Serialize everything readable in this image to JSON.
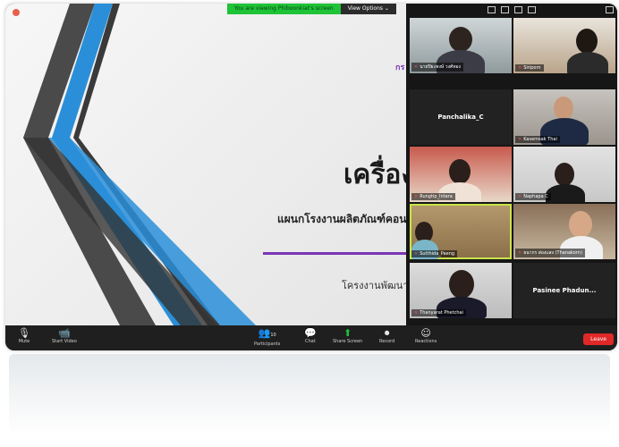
{
  "banner": {
    "message": "You are viewing Phiboonkiat's screen",
    "options_label": "View Options ⌄"
  },
  "slide": {
    "logo_text": "กร",
    "title": "เครื่อง",
    "subtitle": "แผนกโรงงานผลิตภัณฑ์คอน",
    "project": "โครงงานพัฒนา",
    "accent_color": "#7b35b5",
    "stripe_blue": "#2a8fd8",
    "stripe_dark": "#4a4a4a"
  },
  "gallery": {
    "participants": [
      {
        "name": "นายปิยะพงษ์ วงศ์ทอง",
        "video": true
      },
      {
        "name": "Siriporn",
        "video": true
      },
      {
        "name": "Panchalika_C",
        "video": false
      },
      {
        "name": "Kasemsak Thai",
        "video": true
      },
      {
        "name": "Rungtip_Intara",
        "video": true
      },
      {
        "name": "Naphapa C",
        "video": true
      },
      {
        "name": "Sutthida_Paeng",
        "video": true
      },
      {
        "name": "ธนากร ส่องแสง (Thanakorn)",
        "video": true
      },
      {
        "name": "Thanyarat Phetchai",
        "video": true
      },
      {
        "name": "Pasinee Phadun...",
        "video": false
      }
    ]
  },
  "toolbar": {
    "mute": "Mute",
    "start_video": "Start Video",
    "participants": "Participants",
    "participants_count": "10",
    "chat": "Chat",
    "share_screen": "Share Screen",
    "record": "Record",
    "reactions": "Reactions",
    "leave": "Leave"
  }
}
